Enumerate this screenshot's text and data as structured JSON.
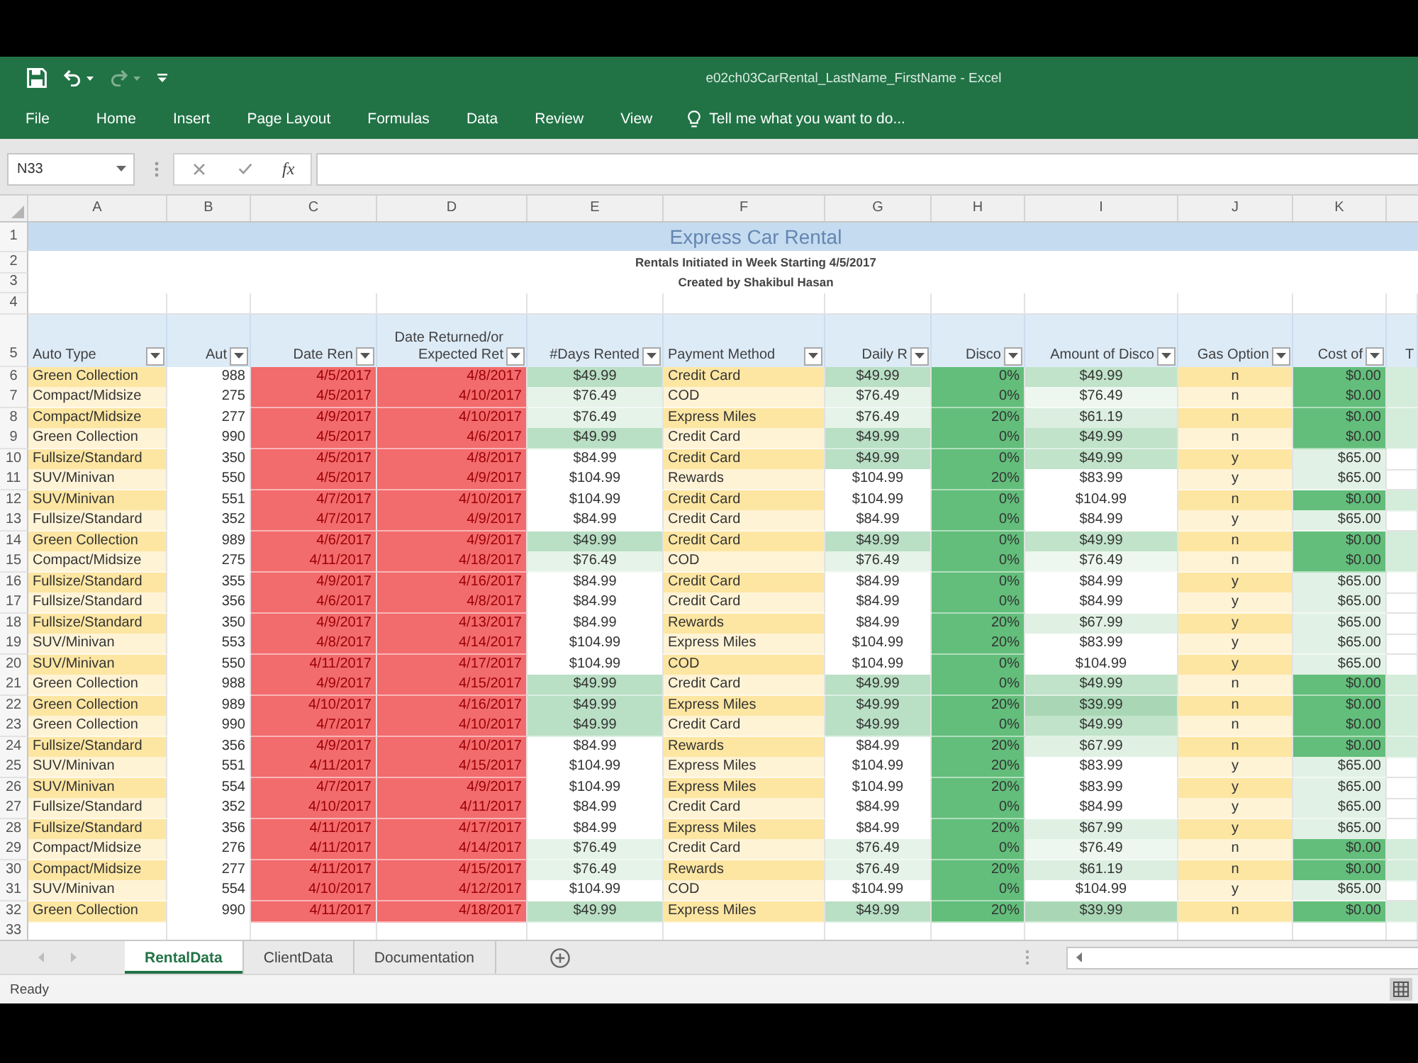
{
  "window": {
    "title": "e02ch03CarRental_LastName_FirstName - Excel"
  },
  "quick_access": [
    {
      "kind": "save",
      "disabled": false
    },
    {
      "kind": "undo",
      "disabled": false
    },
    {
      "kind": "redo",
      "disabled": true
    },
    {
      "kind": "customize",
      "disabled": false
    }
  ],
  "ribbon_tabs": [
    {
      "label": "File",
      "selected": false
    },
    {
      "label": "Home",
      "selected": false
    },
    {
      "label": "Insert",
      "selected": false
    },
    {
      "label": "Page Layout",
      "selected": false
    },
    {
      "label": "Formulas",
      "selected": false
    },
    {
      "label": "Data",
      "selected": false
    },
    {
      "label": "Review",
      "selected": false
    },
    {
      "label": "View",
      "selected": false
    }
  ],
  "tell_me": {
    "text": "Tell me what you want to do..."
  },
  "formula_bar": {
    "name_box": "N33",
    "function_label": "fx"
  },
  "column_letters": [
    "A",
    "B",
    "C",
    "D",
    "E",
    "F",
    "G",
    "H",
    "I",
    "J",
    "K"
  ],
  "rows": [
    {
      "kind": "title",
      "number": "1",
      "text": "Express Car Rental"
    },
    {
      "kind": "subtitle",
      "number": "2",
      "text": "Rentals Initiated in Week Starting 4/5/2017"
    },
    {
      "kind": "subtitle",
      "number": "3",
      "text": "Created by Shakibul Hasan"
    },
    {
      "kind": "blank",
      "number": "4"
    },
    {
      "kind": "header",
      "number": "5",
      "cells": [
        {
          "text": "Auto Type",
          "filter": true
        },
        {
          "text": "Aut",
          "filter": true
        },
        {
          "text": "Date Ren",
          "filter": true
        },
        {
          "text": "Date Returned/or Expected Ret",
          "filter": true
        },
        {
          "text": "#Days Rented",
          "filter": true
        },
        {
          "text": "Payment Method",
          "filter": true
        },
        {
          "text": "Daily R",
          "filter": true
        },
        {
          "text": "Disco",
          "filter": true
        },
        {
          "text": "Amount of Disco",
          "filter": true
        },
        {
          "text": "Gas Option",
          "filter": true
        },
        {
          "text": "Cost of",
          "filter": true
        },
        {
          "text": "T",
          "filter": false
        }
      ]
    },
    {
      "kind": "data",
      "number": "6",
      "cells": [
        {
          "text": "Green Collection",
          "color": "#fde6a2"
        },
        {
          "text": "988",
          "color": "#ffffff"
        },
        {
          "text": "4/5/2017",
          "color": "#f26b6d"
        },
        {
          "text": "4/8/2017",
          "color": "#f26b6d"
        },
        {
          "text": "$49.99",
          "color": "#b9dfc4"
        },
        {
          "text": "Credit Card",
          "color": "#fde6a2"
        },
        {
          "text": "$49.99",
          "color": "#b9dfc4"
        },
        {
          "text": "0%",
          "color": "#63be7b"
        },
        {
          "text": "$49.99",
          "color": "#c0e3c9"
        },
        {
          "text": "n",
          "color": "#fde6a2"
        },
        {
          "text": "$0.00",
          "color": "#63be7b"
        },
        {
          "color": "#d4ecda"
        }
      ]
    },
    {
      "kind": "data",
      "number": "7",
      "cells": [
        {
          "text": "Compact/Midsize",
          "color": "#fff3d6"
        },
        {
          "text": "275",
          "color": "#ffffff"
        },
        {
          "text": "4/5/2017",
          "color": "#f26b6d"
        },
        {
          "text": "4/10/2017",
          "color": "#f26b6d"
        },
        {
          "text": "$76.49",
          "color": "#e5f3e8"
        },
        {
          "text": "COD",
          "color": "#fff3d6"
        },
        {
          "text": "$76.49",
          "color": "#e5f3e8"
        },
        {
          "text": "0%",
          "color": "#63be7b"
        },
        {
          "text": "$76.49",
          "color": "#edf7ef"
        },
        {
          "text": "n",
          "color": "#fff3d6"
        },
        {
          "text": "$0.00",
          "color": "#63be7b"
        },
        {
          "color": "#d4ecda"
        }
      ]
    },
    {
      "kind": "data",
      "number": "8",
      "cells": [
        {
          "text": "Compact/Midsize",
          "color": "#fde6a2"
        },
        {
          "text": "277",
          "color": "#ffffff"
        },
        {
          "text": "4/9/2017",
          "color": "#f26b6d"
        },
        {
          "text": "4/10/2017",
          "color": "#f26b6d"
        },
        {
          "text": "$76.49",
          "color": "#e5f3e8"
        },
        {
          "text": "Express Miles",
          "color": "#fde6a2"
        },
        {
          "text": "$76.49",
          "color": "#e5f3e8"
        },
        {
          "text": "20%",
          "color": "#63be7b"
        },
        {
          "text": "$61.19",
          "color": "#dbeee0"
        },
        {
          "text": "n",
          "color": "#fde6a2"
        },
        {
          "text": "$0.00",
          "color": "#63be7b"
        },
        {
          "color": "#d4ecda"
        }
      ]
    },
    {
      "kind": "data",
      "number": "9",
      "cells": [
        {
          "text": "Green Collection",
          "color": "#fff3d6"
        },
        {
          "text": "990",
          "color": "#ffffff"
        },
        {
          "text": "4/5/2017",
          "color": "#f26b6d"
        },
        {
          "text": "4/6/2017",
          "color": "#f26b6d"
        },
        {
          "text": "$49.99",
          "color": "#b9dfc4"
        },
        {
          "text": "Credit Card",
          "color": "#fff3d6"
        },
        {
          "text": "$49.99",
          "color": "#b9dfc4"
        },
        {
          "text": "0%",
          "color": "#63be7b"
        },
        {
          "text": "$49.99",
          "color": "#c0e3c9"
        },
        {
          "text": "n",
          "color": "#fff3d6"
        },
        {
          "text": "$0.00",
          "color": "#63be7b"
        },
        {
          "color": "#d4ecda"
        }
      ]
    },
    {
      "kind": "data",
      "number": "10",
      "cells": [
        {
          "text": "Fullsize/Standard",
          "color": "#fde6a2"
        },
        {
          "text": "350",
          "color": "#ffffff"
        },
        {
          "text": "4/5/2017",
          "color": "#f26b6d"
        },
        {
          "text": "4/8/2017",
          "color": "#f26b6d"
        },
        {
          "text": "$84.99",
          "color": "#ffffff"
        },
        {
          "text": "Credit Card",
          "color": "#fde6a2"
        },
        {
          "text": "$49.99",
          "color": "#b9dfc4"
        },
        {
          "text": "0%",
          "color": "#63be7b"
        },
        {
          "text": "$49.99",
          "color": "#c0e3c9"
        },
        {
          "text": "y",
          "color": "#fde6a2"
        },
        {
          "text": "$65.00",
          "color": "#e2f1e6"
        }
      ]
    },
    {
      "kind": "data",
      "number": "11",
      "cells": [
        {
          "text": "SUV/Minivan",
          "color": "#fff3d6"
        },
        {
          "text": "550",
          "color": "#ffffff"
        },
        {
          "text": "4/5/2017",
          "color": "#f26b6d"
        },
        {
          "text": "4/9/2017",
          "color": "#f26b6d"
        },
        {
          "text": "$104.99",
          "color": "#ffffff"
        },
        {
          "text": "Rewards",
          "color": "#fff3d6"
        },
        {
          "text": "$104.99",
          "color": "#ffffff"
        },
        {
          "text": "20%",
          "color": "#63be7b"
        },
        {
          "text": "$83.99",
          "color": "#ffffff"
        },
        {
          "text": "y",
          "color": "#fff3d6"
        },
        {
          "text": "$65.00",
          "color": "#e2f1e6"
        }
      ]
    },
    {
      "kind": "data",
      "number": "12",
      "cells": [
        {
          "text": "SUV/Minivan",
          "color": "#fde6a2"
        },
        {
          "text": "551",
          "color": "#ffffff"
        },
        {
          "text": "4/7/2017",
          "color": "#f26b6d"
        },
        {
          "text": "4/10/2017",
          "color": "#f26b6d"
        },
        {
          "text": "$104.99",
          "color": "#ffffff"
        },
        {
          "text": "Credit Card",
          "color": "#fde6a2"
        },
        {
          "text": "$104.99",
          "color": "#ffffff"
        },
        {
          "text": "0%",
          "color": "#63be7b"
        },
        {
          "text": "$104.99",
          "color": "#ffffff"
        },
        {
          "text": "n",
          "color": "#fde6a2"
        },
        {
          "text": "$0.00",
          "color": "#63be7b"
        },
        {
          "color": "#d4ecda"
        }
      ]
    },
    {
      "kind": "data",
      "number": "13",
      "cells": [
        {
          "text": "Fullsize/Standard",
          "color": "#fff3d6"
        },
        {
          "text": "352",
          "color": "#ffffff"
        },
        {
          "text": "4/7/2017",
          "color": "#f26b6d"
        },
        {
          "text": "4/9/2017",
          "color": "#f26b6d"
        },
        {
          "text": "$84.99",
          "color": "#ffffff"
        },
        {
          "text": "Credit Card",
          "color": "#fff3d6"
        },
        {
          "text": "$84.99",
          "color": "#ffffff"
        },
        {
          "text": "0%",
          "color": "#63be7b"
        },
        {
          "text": "$84.99",
          "color": "#ffffff"
        },
        {
          "text": "y",
          "color": "#fff3d6"
        },
        {
          "text": "$65.00",
          "color": "#e2f1e6"
        }
      ]
    },
    {
      "kind": "data",
      "number": "14",
      "cells": [
        {
          "text": "Green Collection",
          "color": "#fde6a2"
        },
        {
          "text": "989",
          "color": "#ffffff"
        },
        {
          "text": "4/6/2017",
          "color": "#f26b6d"
        },
        {
          "text": "4/9/2017",
          "color": "#f26b6d"
        },
        {
          "text": "$49.99",
          "color": "#b9dfc4"
        },
        {
          "text": "Credit Card",
          "color": "#fde6a2"
        },
        {
          "text": "$49.99",
          "color": "#b9dfc4"
        },
        {
          "text": "0%",
          "color": "#63be7b"
        },
        {
          "text": "$49.99",
          "color": "#c0e3c9"
        },
        {
          "text": "n",
          "color": "#fde6a2"
        },
        {
          "text": "$0.00",
          "color": "#63be7b"
        },
        {
          "color": "#d4ecda"
        }
      ]
    },
    {
      "kind": "data",
      "number": "15",
      "cells": [
        {
          "text": "Compact/Midsize",
          "color": "#fff3d6"
        },
        {
          "text": "275",
          "color": "#ffffff"
        },
        {
          "text": "4/11/2017",
          "color": "#f26b6d"
        },
        {
          "text": "4/18/2017",
          "color": "#f26b6d"
        },
        {
          "text": "$76.49",
          "color": "#e5f3e8"
        },
        {
          "text": "COD",
          "color": "#fff3d6"
        },
        {
          "text": "$76.49",
          "color": "#e5f3e8"
        },
        {
          "text": "0%",
          "color": "#63be7b"
        },
        {
          "text": "$76.49",
          "color": "#edf7ef"
        },
        {
          "text": "n",
          "color": "#fff3d6"
        },
        {
          "text": "$0.00",
          "color": "#63be7b"
        },
        {
          "color": "#d4ecda"
        }
      ]
    },
    {
      "kind": "data",
      "number": "16",
      "cells": [
        {
          "text": "Fullsize/Standard",
          "color": "#fde6a2"
        },
        {
          "text": "355",
          "color": "#ffffff"
        },
        {
          "text": "4/9/2017",
          "color": "#f26b6d"
        },
        {
          "text": "4/16/2017",
          "color": "#f26b6d"
        },
        {
          "text": "$84.99",
          "color": "#ffffff"
        },
        {
          "text": "Credit Card",
          "color": "#fde6a2"
        },
        {
          "text": "$84.99",
          "color": "#ffffff"
        },
        {
          "text": "0%",
          "color": "#63be7b"
        },
        {
          "text": "$84.99",
          "color": "#ffffff"
        },
        {
          "text": "y",
          "color": "#fde6a2"
        },
        {
          "text": "$65.00",
          "color": "#e2f1e6"
        }
      ]
    },
    {
      "kind": "data",
      "number": "17",
      "cells": [
        {
          "text": "Fullsize/Standard",
          "color": "#fff3d6"
        },
        {
          "text": "356",
          "color": "#ffffff"
        },
        {
          "text": "4/6/2017",
          "color": "#f26b6d"
        },
        {
          "text": "4/8/2017",
          "color": "#f26b6d"
        },
        {
          "text": "$84.99",
          "color": "#ffffff"
        },
        {
          "text": "Credit Card",
          "color": "#fff3d6"
        },
        {
          "text": "$84.99",
          "color": "#ffffff"
        },
        {
          "text": "0%",
          "color": "#63be7b"
        },
        {
          "text": "$84.99",
          "color": "#ffffff"
        },
        {
          "text": "y",
          "color": "#fff3d6"
        },
        {
          "text": "$65.00",
          "color": "#e2f1e6"
        }
      ]
    },
    {
      "kind": "data",
      "number": "18",
      "cells": [
        {
          "text": "Fullsize/Standard",
          "color": "#fde6a2"
        },
        {
          "text": "350",
          "color": "#ffffff"
        },
        {
          "text": "4/9/2017",
          "color": "#f26b6d"
        },
        {
          "text": "4/13/2017",
          "color": "#f26b6d"
        },
        {
          "text": "$84.99",
          "color": "#ffffff"
        },
        {
          "text": "Rewards",
          "color": "#fde6a2"
        },
        {
          "text": "$84.99",
          "color": "#ffffff"
        },
        {
          "text": "20%",
          "color": "#63be7b"
        },
        {
          "text": "$67.99",
          "color": "#e0f1e4"
        },
        {
          "text": "y",
          "color": "#fde6a2"
        },
        {
          "text": "$65.00",
          "color": "#e2f1e6"
        }
      ]
    },
    {
      "kind": "data",
      "number": "19",
      "cells": [
        {
          "text": "SUV/Minivan",
          "color": "#fff3d6"
        },
        {
          "text": "553",
          "color": "#ffffff"
        },
        {
          "text": "4/8/2017",
          "color": "#f26b6d"
        },
        {
          "text": "4/14/2017",
          "color": "#f26b6d"
        },
        {
          "text": "$104.99",
          "color": "#ffffff"
        },
        {
          "text": "Express Miles",
          "color": "#fff3d6"
        },
        {
          "text": "$104.99",
          "color": "#ffffff"
        },
        {
          "text": "20%",
          "color": "#63be7b"
        },
        {
          "text": "$83.99",
          "color": "#ffffff"
        },
        {
          "text": "y",
          "color": "#fff3d6"
        },
        {
          "text": "$65.00",
          "color": "#e2f1e6"
        }
      ]
    },
    {
      "kind": "data",
      "number": "20",
      "cells": [
        {
          "text": "SUV/Minivan",
          "color": "#fde6a2"
        },
        {
          "text": "550",
          "color": "#ffffff"
        },
        {
          "text": "4/11/2017",
          "color": "#f26b6d"
        },
        {
          "text": "4/17/2017",
          "color": "#f26b6d"
        },
        {
          "text": "$104.99",
          "color": "#ffffff"
        },
        {
          "text": "COD",
          "color": "#fde6a2"
        },
        {
          "text": "$104.99",
          "color": "#ffffff"
        },
        {
          "text": "0%",
          "color": "#63be7b"
        },
        {
          "text": "$104.99",
          "color": "#ffffff"
        },
        {
          "text": "y",
          "color": "#fde6a2"
        },
        {
          "text": "$65.00",
          "color": "#e2f1e6"
        }
      ]
    },
    {
      "kind": "data",
      "number": "21",
      "cells": [
        {
          "text": "Green Collection",
          "color": "#fff3d6"
        },
        {
          "text": "988",
          "color": "#ffffff"
        },
        {
          "text": "4/9/2017",
          "color": "#f26b6d"
        },
        {
          "text": "4/15/2017",
          "color": "#f26b6d"
        },
        {
          "text": "$49.99",
          "color": "#b9dfc4"
        },
        {
          "text": "Credit Card",
          "color": "#fff3d6"
        },
        {
          "text": "$49.99",
          "color": "#b9dfc4"
        },
        {
          "text": "0%",
          "color": "#63be7b"
        },
        {
          "text": "$49.99",
          "color": "#c0e3c9"
        },
        {
          "text": "n",
          "color": "#fff3d6"
        },
        {
          "text": "$0.00",
          "color": "#63be7b"
        },
        {
          "color": "#d4ecda"
        }
      ]
    },
    {
      "kind": "data",
      "number": "22",
      "cells": [
        {
          "text": "Green Collection",
          "color": "#fde6a2"
        },
        {
          "text": "989",
          "color": "#ffffff"
        },
        {
          "text": "4/10/2017",
          "color": "#f26b6d"
        },
        {
          "text": "4/16/2017",
          "color": "#f26b6d"
        },
        {
          "text": "$49.99",
          "color": "#b9dfc4"
        },
        {
          "text": "Express Miles",
          "color": "#fde6a2"
        },
        {
          "text": "$49.99",
          "color": "#b9dfc4"
        },
        {
          "text": "20%",
          "color": "#63be7b"
        },
        {
          "text": "$39.99",
          "color": "#a9d7b5"
        },
        {
          "text": "n",
          "color": "#fde6a2"
        },
        {
          "text": "$0.00",
          "color": "#63be7b"
        },
        {
          "color": "#d4ecda"
        }
      ]
    },
    {
      "kind": "data",
      "number": "23",
      "cells": [
        {
          "text": "Green Collection",
          "color": "#fff3d6"
        },
        {
          "text": "990",
          "color": "#ffffff"
        },
        {
          "text": "4/7/2017",
          "color": "#f26b6d"
        },
        {
          "text": "4/10/2017",
          "color": "#f26b6d"
        },
        {
          "text": "$49.99",
          "color": "#b9dfc4"
        },
        {
          "text": "Credit Card",
          "color": "#fff3d6"
        },
        {
          "text": "$49.99",
          "color": "#b9dfc4"
        },
        {
          "text": "0%",
          "color": "#63be7b"
        },
        {
          "text": "$49.99",
          "color": "#c0e3c9"
        },
        {
          "text": "n",
          "color": "#fff3d6"
        },
        {
          "text": "$0.00",
          "color": "#63be7b"
        },
        {
          "color": "#d4ecda"
        }
      ]
    },
    {
      "kind": "data",
      "number": "24",
      "cells": [
        {
          "text": "Fullsize/Standard",
          "color": "#fde6a2"
        },
        {
          "text": "356",
          "color": "#ffffff"
        },
        {
          "text": "4/9/2017",
          "color": "#f26b6d"
        },
        {
          "text": "4/10/2017",
          "color": "#f26b6d"
        },
        {
          "text": "$84.99",
          "color": "#ffffff"
        },
        {
          "text": "Rewards",
          "color": "#fde6a2"
        },
        {
          "text": "$84.99",
          "color": "#ffffff"
        },
        {
          "text": "20%",
          "color": "#63be7b"
        },
        {
          "text": "$67.99",
          "color": "#e0f1e4"
        },
        {
          "text": "n",
          "color": "#fde6a2"
        },
        {
          "text": "$0.00",
          "color": "#63be7b"
        },
        {
          "color": "#d4ecda"
        }
      ]
    },
    {
      "kind": "data",
      "number": "25",
      "cells": [
        {
          "text": "SUV/Minivan",
          "color": "#fff3d6"
        },
        {
          "text": "551",
          "color": "#ffffff"
        },
        {
          "text": "4/11/2017",
          "color": "#f26b6d"
        },
        {
          "text": "4/15/2017",
          "color": "#f26b6d"
        },
        {
          "text": "$104.99",
          "color": "#ffffff"
        },
        {
          "text": "Express Miles",
          "color": "#fff3d6"
        },
        {
          "text": "$104.99",
          "color": "#ffffff"
        },
        {
          "text": "20%",
          "color": "#63be7b"
        },
        {
          "text": "$83.99",
          "color": "#ffffff"
        },
        {
          "text": "y",
          "color": "#fff3d6"
        },
        {
          "text": "$65.00",
          "color": "#e2f1e6"
        }
      ]
    },
    {
      "kind": "data",
      "number": "26",
      "cells": [
        {
          "text": "SUV/Minivan",
          "color": "#fde6a2"
        },
        {
          "text": "554",
          "color": "#ffffff"
        },
        {
          "text": "4/7/2017",
          "color": "#f26b6d"
        },
        {
          "text": "4/9/2017",
          "color": "#f26b6d"
        },
        {
          "text": "$104.99",
          "color": "#ffffff"
        },
        {
          "text": "Express Miles",
          "color": "#fde6a2"
        },
        {
          "text": "$104.99",
          "color": "#ffffff"
        },
        {
          "text": "20%",
          "color": "#63be7b"
        },
        {
          "text": "$83.99",
          "color": "#ffffff"
        },
        {
          "text": "y",
          "color": "#fde6a2"
        },
        {
          "text": "$65.00",
          "color": "#e2f1e6"
        }
      ]
    },
    {
      "kind": "data",
      "number": "27",
      "cells": [
        {
          "text": "Fullsize/Standard",
          "color": "#fff3d6"
        },
        {
          "text": "352",
          "color": "#ffffff"
        },
        {
          "text": "4/10/2017",
          "color": "#f26b6d"
        },
        {
          "text": "4/11/2017",
          "color": "#f26b6d"
        },
        {
          "text": "$84.99",
          "color": "#ffffff"
        },
        {
          "text": "Credit Card",
          "color": "#fff3d6"
        },
        {
          "text": "$84.99",
          "color": "#ffffff"
        },
        {
          "text": "0%",
          "color": "#63be7b"
        },
        {
          "text": "$84.99",
          "color": "#ffffff"
        },
        {
          "text": "y",
          "color": "#fff3d6"
        },
        {
          "text": "$65.00",
          "color": "#e2f1e6"
        }
      ]
    },
    {
      "kind": "data",
      "number": "28",
      "cells": [
        {
          "text": "Fullsize/Standard",
          "color": "#fde6a2"
        },
        {
          "text": "356",
          "color": "#ffffff"
        },
        {
          "text": "4/11/2017",
          "color": "#f26b6d"
        },
        {
          "text": "4/17/2017",
          "color": "#f26b6d"
        },
        {
          "text": "$84.99",
          "color": "#ffffff"
        },
        {
          "text": "Express Miles",
          "color": "#fde6a2"
        },
        {
          "text": "$84.99",
          "color": "#ffffff"
        },
        {
          "text": "20%",
          "color": "#63be7b"
        },
        {
          "text": "$67.99",
          "color": "#e0f1e4"
        },
        {
          "text": "y",
          "color": "#fde6a2"
        },
        {
          "text": "$65.00",
          "color": "#e2f1e6"
        }
      ]
    },
    {
      "kind": "data",
      "number": "29",
      "cells": [
        {
          "text": "Compact/Midsize",
          "color": "#fff3d6"
        },
        {
          "text": "276",
          "color": "#ffffff"
        },
        {
          "text": "4/11/2017",
          "color": "#f26b6d"
        },
        {
          "text": "4/14/2017",
          "color": "#f26b6d"
        },
        {
          "text": "$76.49",
          "color": "#e5f3e8"
        },
        {
          "text": "Credit Card",
          "color": "#fff3d6"
        },
        {
          "text": "$76.49",
          "color": "#e5f3e8"
        },
        {
          "text": "0%",
          "color": "#63be7b"
        },
        {
          "text": "$76.49",
          "color": "#edf7ef"
        },
        {
          "text": "n",
          "color": "#fff3d6"
        },
        {
          "text": "$0.00",
          "color": "#63be7b"
        },
        {
          "color": "#d4ecda"
        }
      ]
    },
    {
      "kind": "data",
      "number": "30",
      "cells": [
        {
          "text": "Compact/Midsize",
          "color": "#fde6a2"
        },
        {
          "text": "277",
          "color": "#ffffff"
        },
        {
          "text": "4/11/2017",
          "color": "#f26b6d"
        },
        {
          "text": "4/15/2017",
          "color": "#f26b6d"
        },
        {
          "text": "$76.49",
          "color": "#e5f3e8"
        },
        {
          "text": "Rewards",
          "color": "#fde6a2"
        },
        {
          "text": "$76.49",
          "color": "#e5f3e8"
        },
        {
          "text": "20%",
          "color": "#63be7b"
        },
        {
          "text": "$61.19",
          "color": "#dbeee0"
        },
        {
          "text": "n",
          "color": "#fde6a2"
        },
        {
          "text": "$0.00",
          "color": "#63be7b"
        },
        {
          "color": "#d4ecda"
        }
      ]
    },
    {
      "kind": "data",
      "number": "31",
      "cells": [
        {
          "text": "SUV/Minivan",
          "color": "#fff3d6"
        },
        {
          "text": "554",
          "color": "#ffffff"
        },
        {
          "text": "4/10/2017",
          "color": "#f26b6d"
        },
        {
          "text": "4/12/2017",
          "color": "#f26b6d"
        },
        {
          "text": "$104.99",
          "color": "#ffffff"
        },
        {
          "text": "COD",
          "color": "#fff3d6"
        },
        {
          "text": "$104.99",
          "color": "#ffffff"
        },
        {
          "text": "0%",
          "color": "#63be7b"
        },
        {
          "text": "$104.99",
          "color": "#ffffff"
        },
        {
          "text": "y",
          "color": "#fff3d6"
        },
        {
          "text": "$65.00",
          "color": "#e2f1e6"
        }
      ]
    },
    {
      "kind": "data",
      "number": "32",
      "cells": [
        {
          "text": "Green Collection",
          "color": "#fde6a2"
        },
        {
          "text": "990",
          "color": "#ffffff"
        },
        {
          "text": "4/11/2017",
          "color": "#f26b6d"
        },
        {
          "text": "4/18/2017",
          "color": "#f26b6d"
        },
        {
          "text": "$49.99",
          "color": "#b9dfc4"
        },
        {
          "text": "Express Miles",
          "color": "#fde6a2"
        },
        {
          "text": "$49.99",
          "color": "#b9dfc4"
        },
        {
          "text": "20%",
          "color": "#63be7b"
        },
        {
          "text": "$39.99",
          "color": "#a9d7b5"
        },
        {
          "text": "n",
          "color": "#fde6a2"
        },
        {
          "text": "$0.00",
          "color": "#63be7b"
        },
        {
          "color": "#d4ecda"
        }
      ]
    },
    {
      "kind": "blank",
      "number": "33"
    }
  ],
  "sheet_tabs": [
    {
      "label": "RentalData",
      "selected": true
    },
    {
      "label": "ClientData",
      "selected": false
    },
    {
      "label": "Documentation",
      "selected": false
    }
  ],
  "status_bar": {
    "text": "Ready"
  }
}
